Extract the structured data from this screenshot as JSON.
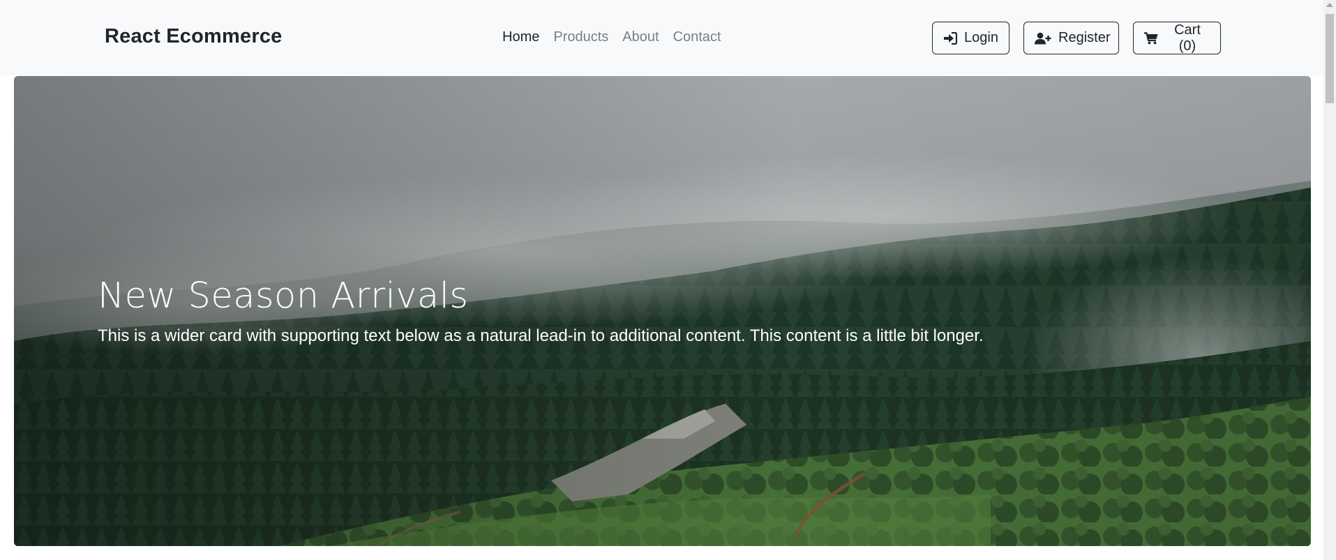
{
  "navbar": {
    "brand": "React Ecommerce",
    "links": [
      {
        "label": "Home",
        "active": true
      },
      {
        "label": "Products",
        "active": false
      },
      {
        "label": "About",
        "active": false
      },
      {
        "label": "Contact",
        "active": false
      }
    ],
    "buttons": {
      "login": {
        "label": "Login",
        "icon": "sign-in-icon"
      },
      "register": {
        "label": "Register",
        "icon": "user-plus-icon"
      },
      "cart": {
        "label": "Cart (0)",
        "icon": "shopping-cart-icon"
      }
    }
  },
  "hero": {
    "title": "New Season Arrivals",
    "text": "This is a wider card with supporting text below as a natural lead-in to additional content. This content is a little bit longer.",
    "image": "misty-forest-hillside"
  },
  "colors": {
    "navbar_bg": "#f8f9fa",
    "text_dark": "#212529",
    "link_muted": "#7a7f85",
    "hero_text": "#ffffff"
  }
}
